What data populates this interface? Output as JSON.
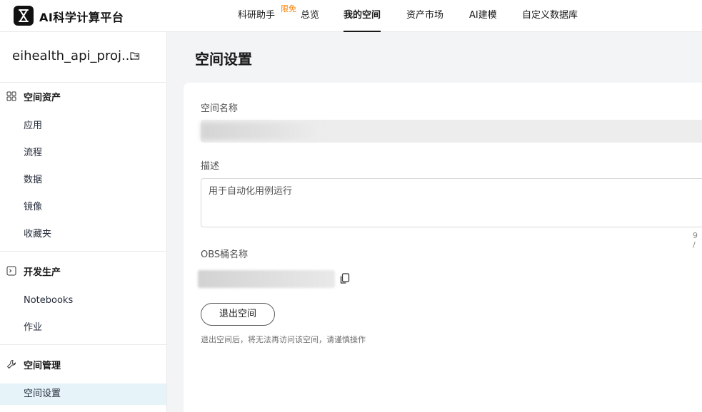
{
  "header": {
    "brand": "AI科学计算平台",
    "nav": [
      {
        "label": "科研助手"
      },
      {
        "label": "总览"
      },
      {
        "label": "我的空间"
      },
      {
        "label": "资产市场"
      },
      {
        "label": "AI建模"
      },
      {
        "label": "自定义数据库"
      }
    ],
    "badge": "限免"
  },
  "sidebar": {
    "project_title": "eihealth_api_proj...",
    "groups": [
      {
        "title": "空间资产",
        "items": [
          "应用",
          "流程",
          "数据",
          "镜像",
          "收藏夹"
        ]
      },
      {
        "title": "开发生产",
        "items": [
          "Notebooks",
          "作业"
        ]
      },
      {
        "title": "空间管理",
        "items": [
          "空间设置"
        ]
      }
    ]
  },
  "main": {
    "page_title": "空间设置",
    "space_name_label": "空间名称",
    "description_label": "描述",
    "description_value": "用于自动化用例运行",
    "char_counter": "9 /",
    "obs_label": "OBS桶名称",
    "exit_button": "退出空间",
    "exit_hint": "退出空间后，将无法再访问该空间，请谨慎操作"
  }
}
